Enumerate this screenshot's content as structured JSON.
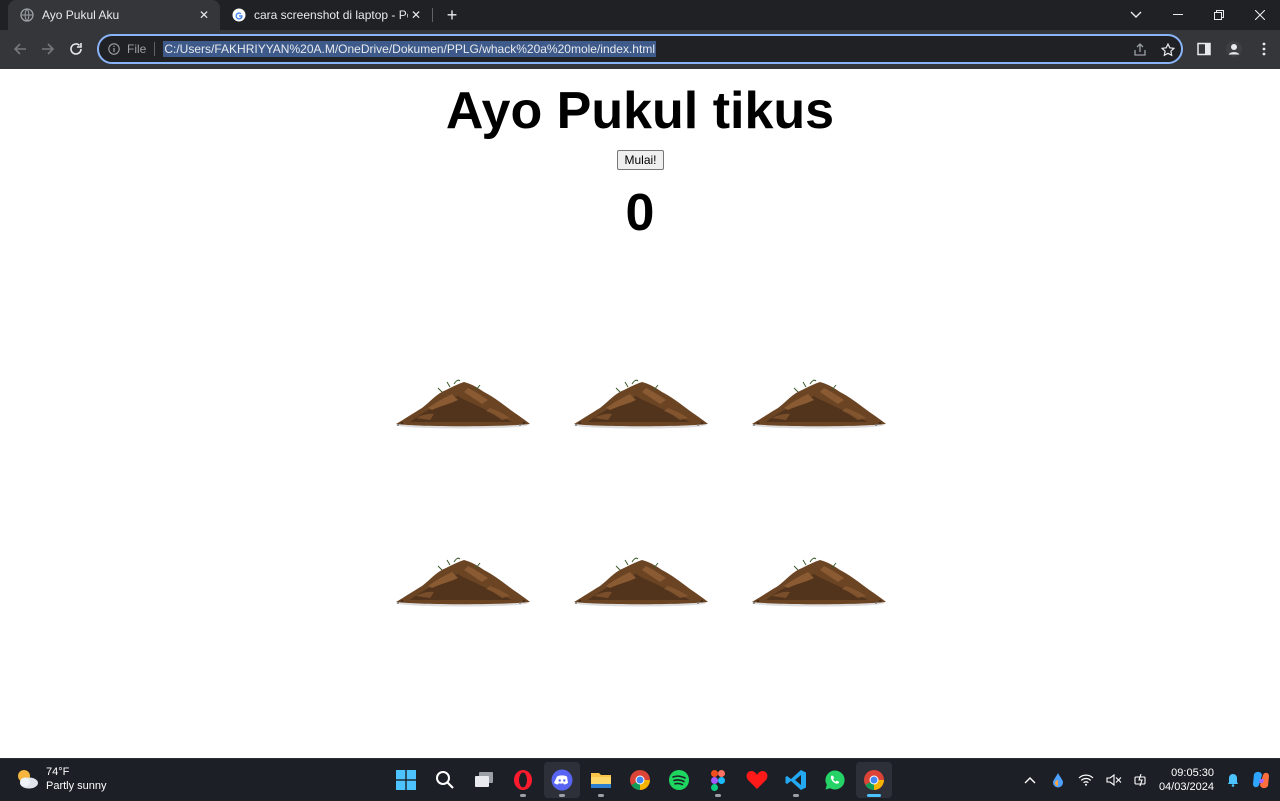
{
  "browser": {
    "tabs": [
      {
        "title": "Ayo Pukul Aku",
        "active": true,
        "icon": "globe-icon"
      },
      {
        "title": "cara screenshot di laptop - Penelusuran Google",
        "active": false,
        "icon": "google-icon"
      }
    ],
    "address": {
      "scheme_label": "File",
      "url": "C:/Users/FAKHRIYYAN%20A.M/OneDrive/Dokumen/PPLG/whack%20a%20mole/index.html"
    }
  },
  "page": {
    "title": "Ayo Pukul tikus",
    "start_button": "Mulai!",
    "score": "0",
    "holes": 6,
    "colors": {
      "dirt_dark": "#4a2f1a",
      "dirt_mid": "#6b4424",
      "dirt_light": "#8a5a32"
    }
  },
  "taskbar": {
    "weather": {
      "temp": "74°F",
      "condition": "Partly sunny"
    },
    "apps": [
      "start-icon",
      "search-icon",
      "task-view-icon",
      "opera-icon",
      "discord-icon",
      "file-explorer-icon",
      "chrome-icon",
      "spotify-icon",
      "figma-icon",
      "undertale-heart-icon",
      "vscode-icon",
      "whatsapp-icon",
      "chrome-icon"
    ],
    "clock": {
      "time": "09:05:30",
      "date": "04/03/2024"
    }
  }
}
